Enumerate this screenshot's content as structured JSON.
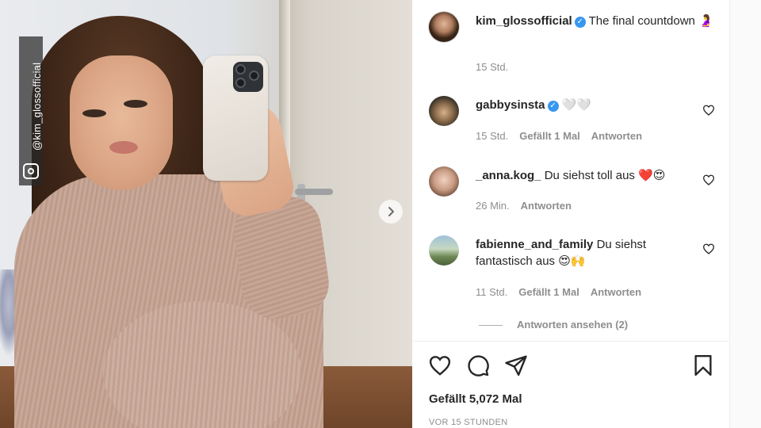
{
  "photo": {
    "watermark_handle": "@kim_glossofficial"
  },
  "post": {
    "author": "kim_glossofficial",
    "caption": "The final countdown 🤰",
    "age": "15 Std."
  },
  "comments": [
    {
      "user": "gabbysinsta",
      "verified": true,
      "text": "🤍🤍",
      "age": "15 Std.",
      "likes": "Gefällt 1 Mal",
      "reply": "Antworten"
    },
    {
      "user": "_anna.kog_",
      "verified": false,
      "text": "Du siehst toll aus ❤️😍",
      "age": "26 Min.",
      "likes": "",
      "reply": "Antworten"
    },
    {
      "user": "fabienne_and_family",
      "verified": false,
      "text": "Du siehst fantastisch aus 😍🙌",
      "age": "11 Std.",
      "likes": "Gefällt 1 Mal",
      "reply": "Antworten"
    }
  ],
  "thread_toggle": "Antworten ansehen (2)",
  "footer": {
    "likes": "Gefällt 5,072 Mal",
    "timestamp": "VOR 15 STUNDEN"
  },
  "icons": {
    "like": "heart-icon",
    "comment": "comment-icon",
    "share": "paper-plane-icon",
    "save": "bookmark-icon",
    "next": "chevron-right-icon",
    "verified": "verified-badge-icon",
    "instagram": "instagram-icon"
  },
  "colors": {
    "verified": "#3897f0",
    "text": "#262626",
    "muted": "#8e8e8e"
  }
}
